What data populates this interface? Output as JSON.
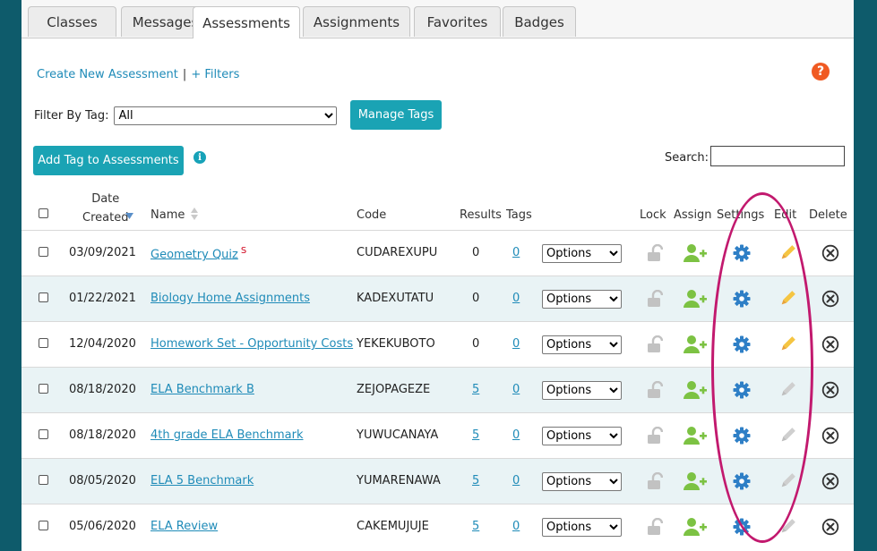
{
  "tabs": [
    {
      "label": "Classes",
      "active": false
    },
    {
      "label": "Messages",
      "active": false
    },
    {
      "label": "Assessments",
      "active": true
    },
    {
      "label": "Assignments",
      "active": false
    },
    {
      "label": "Favorites",
      "active": false
    },
    {
      "label": "Badges",
      "active": false
    }
  ],
  "toolbar": {
    "create_link": "Create New Assessment",
    "separator": "|",
    "filters_link": "+ Filters",
    "help_glyph": "?"
  },
  "filter": {
    "label": "Filter By Tag:",
    "selected": "All",
    "manage_tags_label": "Manage Tags"
  },
  "add_tag_label": "Add Tag to Assessments",
  "search": {
    "label": "Search:",
    "value": ""
  },
  "columns": {
    "date_line1": "Date",
    "date_line2": "Created",
    "name": "Name",
    "code": "Code",
    "results": "Results",
    "tags": "Tags",
    "lock": "Lock",
    "assign": "Assign",
    "settings": "Settings",
    "edit": "Edit",
    "delete": "Delete"
  },
  "rows": [
    {
      "date": "03/09/2021",
      "name": "Geometry Quiz",
      "badge": "S",
      "code": "CUDAREXUPU",
      "results": "0",
      "results_link": false,
      "tags": "0",
      "option": "Options",
      "edit_enabled": true
    },
    {
      "date": "01/22/2021",
      "name": "Biology Home Assignments",
      "badge": "",
      "code": "KADEXUTATU",
      "results": "0",
      "results_link": false,
      "tags": "0",
      "option": "Options",
      "edit_enabled": true
    },
    {
      "date": "12/04/2020",
      "name": "Homework Set - Opportunity Costs",
      "badge": "",
      "code": "YEKEKUBOTO",
      "results": "0",
      "results_link": false,
      "tags": "0",
      "option": "Options",
      "edit_enabled": true
    },
    {
      "date": "08/18/2020",
      "name": "ELA Benchmark B",
      "badge": "",
      "code": "ZEJOPAGEZE",
      "results": "5",
      "results_link": true,
      "tags": "0",
      "option": "Options",
      "edit_enabled": false
    },
    {
      "date": "08/18/2020",
      "name": "4th grade ELA Benchmark",
      "badge": "",
      "code": "YUWUCANAYA",
      "results": "5",
      "results_link": true,
      "tags": "0",
      "option": "Options",
      "edit_enabled": false
    },
    {
      "date": "08/05/2020",
      "name": "ELA 5 Benchmark",
      "badge": "",
      "code": "YUMARENAWA",
      "results": "5",
      "results_link": true,
      "tags": "0",
      "option": "Options",
      "edit_enabled": false
    },
    {
      "date": "05/06/2020",
      "name": "ELA Review",
      "badge": "",
      "code": "CAKEMUJUJE",
      "results": "5",
      "results_link": true,
      "tags": "0",
      "option": "Options",
      "edit_enabled": false
    }
  ],
  "colors": {
    "accent": "#1aa3b4",
    "link": "#1f8bb8",
    "assign_green": "#7cc243",
    "settings_blue": "#2e7fc6",
    "edit_yellow": "#f5c542",
    "annotation": "#c2196e"
  }
}
